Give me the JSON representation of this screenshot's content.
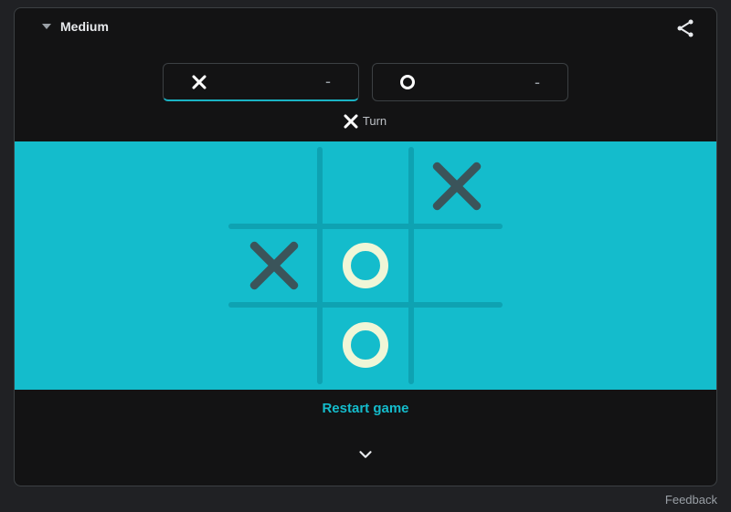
{
  "difficulty": {
    "label": "Medium"
  },
  "share": {
    "icon": "share-icon"
  },
  "score": {
    "x": {
      "value": "-"
    },
    "o": {
      "value": "-"
    }
  },
  "turn": {
    "label": "Turn",
    "player": "X"
  },
  "board": {
    "cells": [
      "",
      "",
      "X",
      "X",
      "O",
      "",
      "",
      "O",
      ""
    ],
    "colors": {
      "bg": "#14bccc",
      "x": "#3b545a",
      "o": "#f0f6d7"
    }
  },
  "restart": {
    "label": "Restart game"
  },
  "footer": {
    "feedback": "Feedback"
  }
}
